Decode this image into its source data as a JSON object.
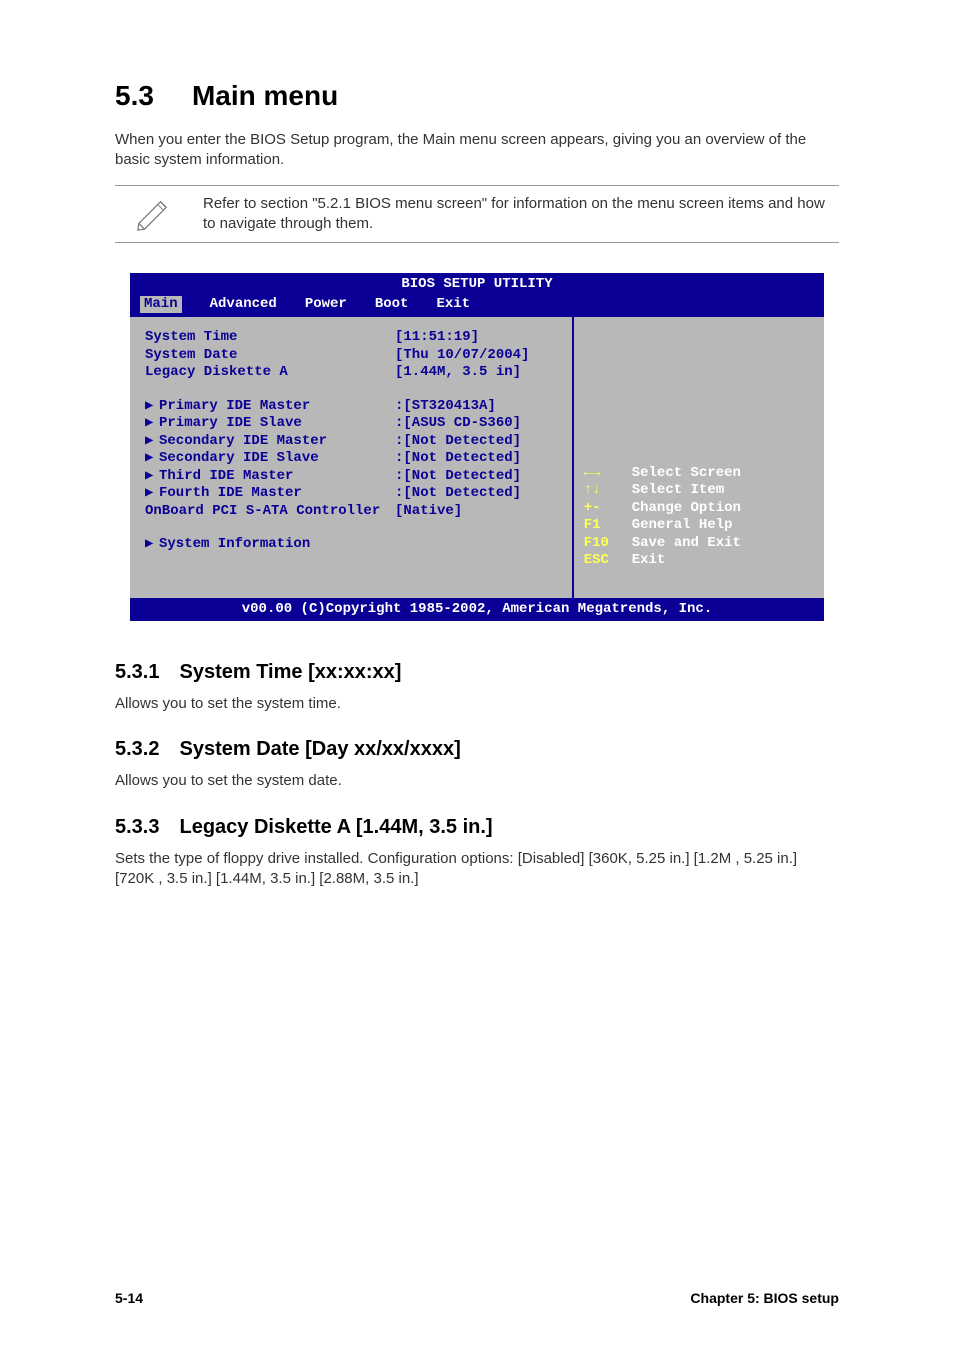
{
  "heading": {
    "number": "5.3",
    "title": "Main menu"
  },
  "intro": "When you enter the BIOS Setup program, the Main menu screen appears, giving you an overview of the basic system information.",
  "note": "Refer to section \"5.2.1 BIOS menu screen\" for information on the menu screen items and how to navigate through them.",
  "bios": {
    "title": "BIOS SETUP UTILITY",
    "menu": [
      "Main",
      "Advanced",
      "Power",
      "Boot",
      "Exit"
    ],
    "selected_menu": "Main",
    "fields": {
      "system_time_label": "System Time",
      "system_time_value": "[11:51:19]",
      "system_date_label": "System Date",
      "system_date_value": "[Thu 10/07/2004]",
      "legacy_label": "Legacy Diskette A",
      "legacy_value": "[1.44M, 3.5 in]",
      "primary_master_label": "Primary IDE Master",
      "primary_master_value": ":[ST320413A]",
      "primary_slave_label": "Primary IDE Slave",
      "primary_slave_value": ":[ASUS CD-S360]",
      "secondary_master_label": "Secondary IDE Master",
      "secondary_master_value": ":[Not Detected]",
      "secondary_slave_label": "Secondary IDE Slave",
      "secondary_slave_value": ":[Not Detected]",
      "third_master_label": "Third IDE Master",
      "third_master_value": ":[Not Detected]",
      "fourth_master_label": "Fourth IDE Master",
      "fourth_master_value": ":[Not Detected]",
      "sata_label": "OnBoard PCI S-ATA Controller",
      "sata_value": "[Native]",
      "sysinfo_label": "System Information"
    },
    "help": [
      {
        "key": "←→",
        "text": "Select Screen"
      },
      {
        "key": "↑↓",
        "text": "Select Item"
      },
      {
        "key": "+-",
        "text": "Change Option"
      },
      {
        "key": "F1",
        "text": "General Help"
      },
      {
        "key": "F10",
        "text": "Save and Exit"
      },
      {
        "key": "ESC",
        "text": "Exit"
      }
    ],
    "footer": "v00.00 (C)Copyright 1985-2002, American Megatrends, Inc."
  },
  "sections": [
    {
      "number": "5.3.1",
      "title": "System Time [xx:xx:xx]",
      "body": "Allows you to set the system time."
    },
    {
      "number": "5.3.2",
      "title": "System Date [Day xx/xx/xxxx]",
      "body": "Allows you to set the system date."
    },
    {
      "number": "5.3.3",
      "title": "Legacy Diskette A [1.44M, 3.5 in.]",
      "body": "Sets the type of floppy drive installed. Configuration options: [Disabled] [360K, 5.25 in.] [1.2M , 5.25 in.] [720K , 3.5 in.] [1.44M, 3.5 in.] [2.88M, 3.5 in.]"
    }
  ],
  "footer": {
    "left": "5-14",
    "right": "Chapter 5: BIOS setup"
  }
}
